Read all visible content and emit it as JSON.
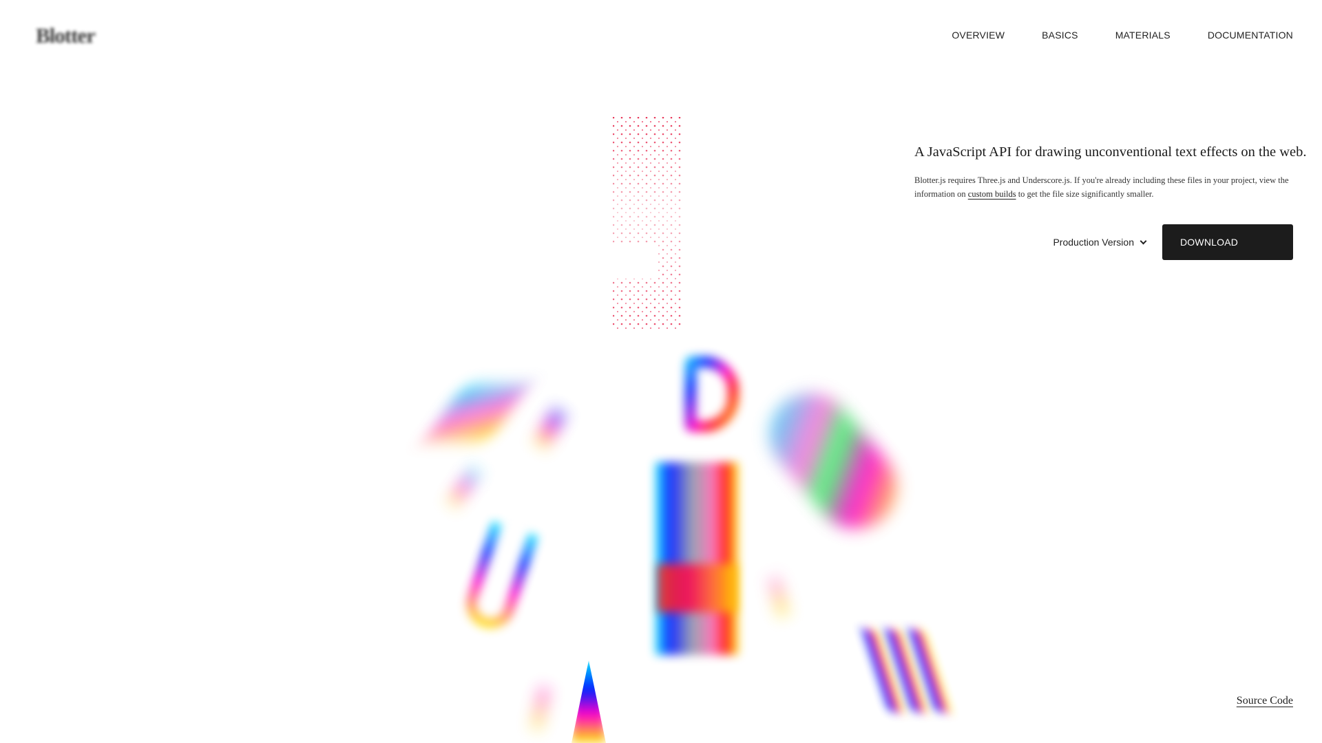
{
  "header": {
    "logo_text": "Blotter",
    "nav": [
      "OVERVIEW",
      "BASICS",
      "MATERIALS",
      "DOCUMENTATION"
    ]
  },
  "info": {
    "tagline": "A JavaScript API for drawing unconventional text effects on the web.",
    "desc_before": "Blotter.js requires Three.js and Underscore.js. If you're already including these files in your project, view the information on ",
    "desc_link": "custom builds",
    "desc_after": " to get the file size significantly smaller."
  },
  "actions": {
    "version_selected": "Production Version",
    "download_label": "DOWNLOAD"
  },
  "footer": {
    "source_code_label": "Source Code"
  },
  "colors": {
    "button_bg": "#1c1c1c",
    "halftone_dot": "#e8375a",
    "spectrum": [
      "#00e5ff",
      "#0022ff",
      "#ff00cc",
      "#ff2a1a",
      "#ffee00"
    ]
  },
  "icons": {
    "version_dropdown": "chevron-down-icon"
  }
}
